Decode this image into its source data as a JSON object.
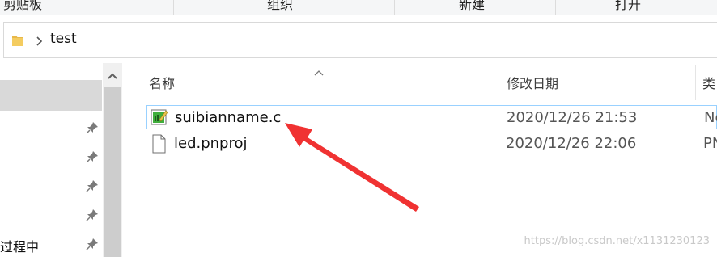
{
  "ribbon": {
    "groups": [
      "剪贴板",
      "组织",
      "新建",
      "打开"
    ]
  },
  "address": {
    "crumb": "test"
  },
  "nav": {
    "visible_text": "过程中"
  },
  "columns": {
    "name": "名称",
    "date": "修改日期",
    "type": "类"
  },
  "files": [
    {
      "name": "suibianname.c",
      "date": "2020/12/26 21:53",
      "type": "Nc",
      "selected": true,
      "icon": "c-source-file-icon"
    },
    {
      "name": "led.pnproj",
      "date": "2020/12/26 22:06",
      "type": "PN",
      "selected": false,
      "icon": "blank-file-icon"
    }
  ],
  "annotation": {
    "color": "#f03232",
    "icon": "red-arrow"
  },
  "watermark": "https://blog.csdn.net/x1131230123"
}
